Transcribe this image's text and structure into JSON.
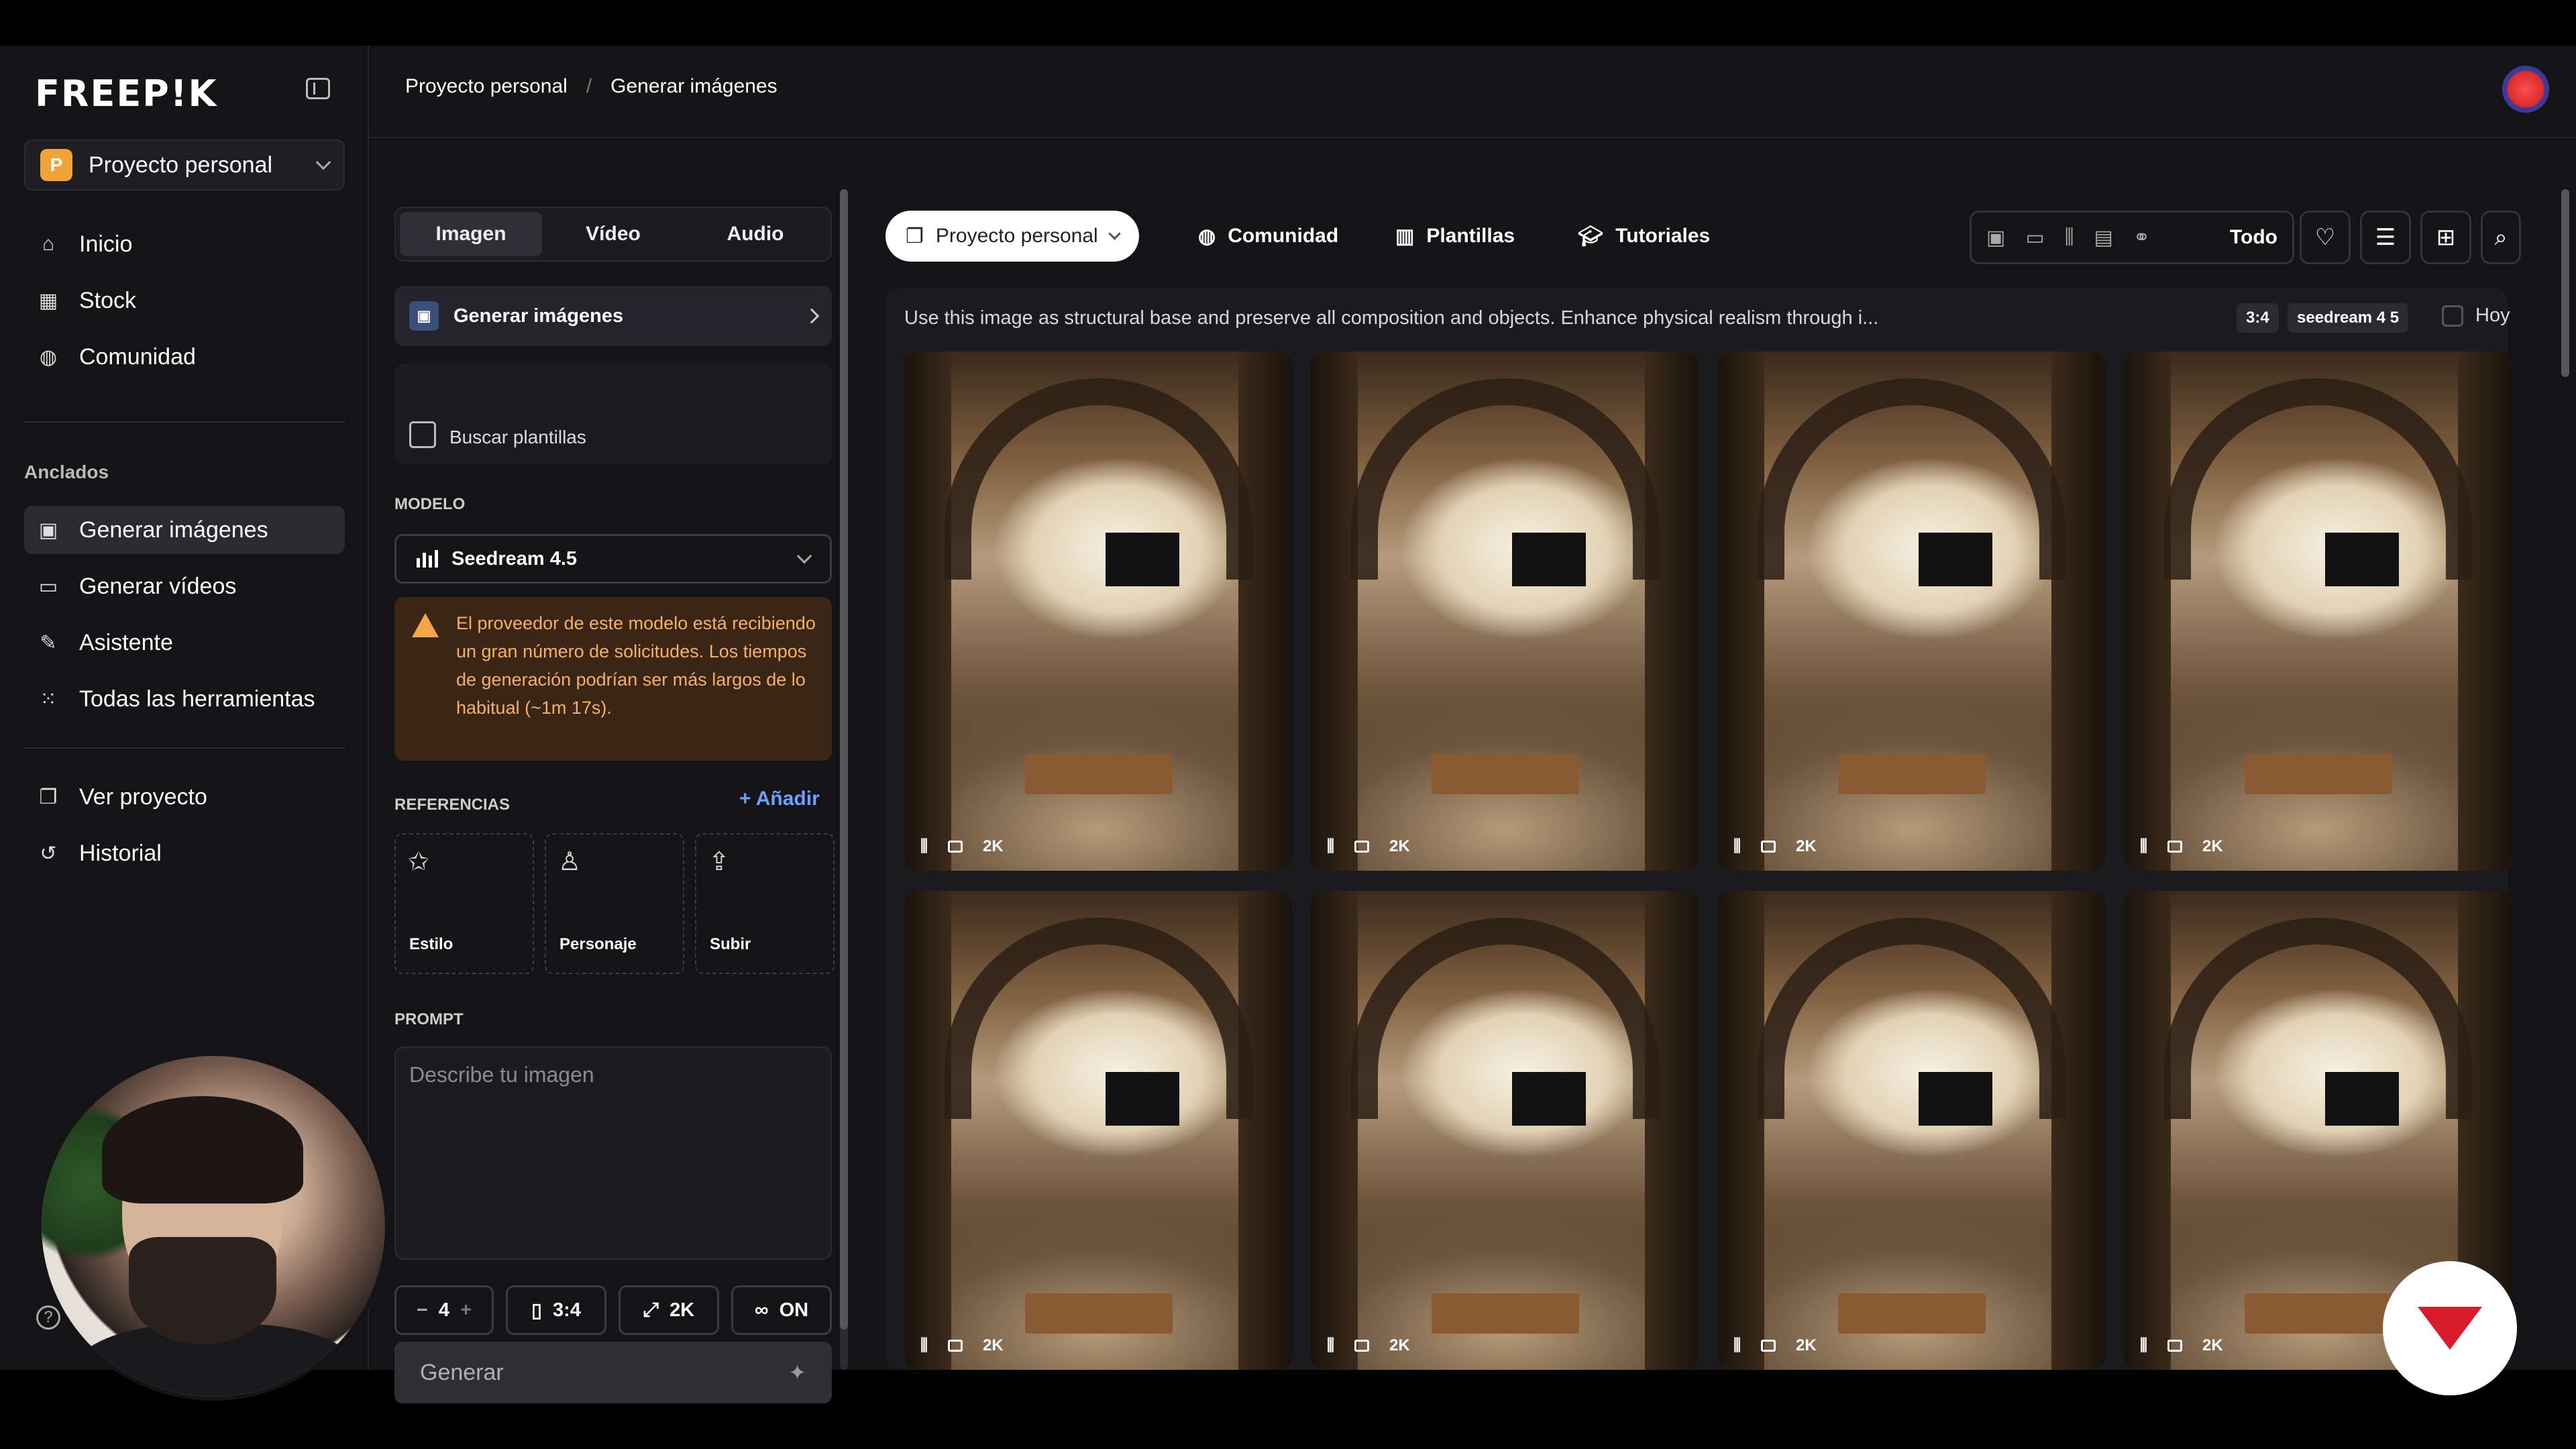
{
  "nav": {
    "logo": "FREEP!K",
    "project": {
      "badge": "P",
      "label": "Proyecto personal"
    },
    "items": [
      {
        "label": "Inicio",
        "icon": "home-icon"
      },
      {
        "label": "Stock",
        "icon": "stock-icon"
      },
      {
        "label": "Comunidad",
        "icon": "globe-icon"
      }
    ],
    "pinned_title": "Anclados",
    "pinned": [
      {
        "label": "Generar imágenes",
        "icon": "image-icon",
        "active": true
      },
      {
        "label": "Generar vídeos",
        "icon": "video-icon"
      },
      {
        "label": "Asistente",
        "icon": "assistant-icon"
      },
      {
        "label": "Todas las herramientas",
        "icon": "grid-icon"
      }
    ],
    "footer": [
      {
        "label": "Ver proyecto",
        "icon": "project-icon"
      },
      {
        "label": "Historial",
        "icon": "history-icon"
      }
    ],
    "help": "?"
  },
  "header": {
    "breadcrumb": [
      "Proyecto personal",
      "/",
      "Generar imágenes"
    ]
  },
  "panel": {
    "tabs": [
      "Imagen",
      "Vídeo",
      "Audio"
    ],
    "generate_row": "Generar imágenes",
    "templates_row": "Buscar plantillas",
    "model_label": "MODELO",
    "model_value": "Seedream 4.5",
    "warning": "El proveedor de este modelo está recibiendo un gran número de solicitudes. Los tiempos de generación podrían ser más largos de lo habitual (~1m 17s).",
    "references_label": "REFERENCIAS",
    "add_label": "Añadir",
    "refs": [
      "Estilo",
      "Personaje",
      "Subir"
    ],
    "prompt_label": "PROMPT",
    "prompt_placeholder": "Describe tu imagen",
    "count": "4",
    "minus": "−",
    "plus": "+",
    "ratio": "3:4",
    "resolution": "2K",
    "loop": "ON",
    "generate_button": "Generar"
  },
  "right": {
    "chips": [
      "Proyecto personal",
      "Comunidad",
      "Plantillas",
      "Tutoriales"
    ],
    "filter_all": "Todo",
    "prompt_text": "Use this image as structural base and preserve all composition and objects. Enhance physical realism through i...",
    "tag_ratio": "3:4",
    "tag_model": "seedream 4 5",
    "today": "Hoy",
    "thumb_badge": "2K"
  }
}
